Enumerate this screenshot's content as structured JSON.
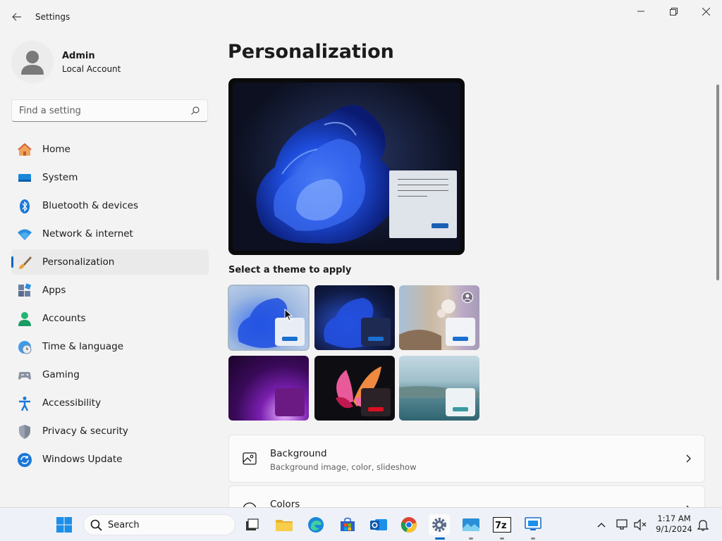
{
  "window": {
    "title": "Settings"
  },
  "profile": {
    "name": "Admin",
    "account_type": "Local Account"
  },
  "search": {
    "placeholder": "Find a setting"
  },
  "sidebar": {
    "items": [
      {
        "label": "Home",
        "icon": "home-icon"
      },
      {
        "label": "System",
        "icon": "system-icon"
      },
      {
        "label": "Bluetooth & devices",
        "icon": "bluetooth-icon"
      },
      {
        "label": "Network & internet",
        "icon": "wifi-icon"
      },
      {
        "label": "Personalization",
        "icon": "brush-icon",
        "active": true
      },
      {
        "label": "Apps",
        "icon": "apps-icon"
      },
      {
        "label": "Accounts",
        "icon": "person-icon"
      },
      {
        "label": "Time & language",
        "icon": "globe-clock-icon"
      },
      {
        "label": "Gaming",
        "icon": "gamepad-icon"
      },
      {
        "label": "Accessibility",
        "icon": "accessibility-icon"
      },
      {
        "label": "Privacy & security",
        "icon": "shield-icon"
      },
      {
        "label": "Windows Update",
        "icon": "update-icon"
      }
    ]
  },
  "main": {
    "title": "Personalization",
    "theme_section_label": "Select a theme to apply",
    "themes": [
      {
        "name": "windows-light",
        "selected": true
      },
      {
        "name": "windows-dark"
      },
      {
        "name": "spotlight"
      },
      {
        "name": "glow"
      },
      {
        "name": "captured-motion"
      },
      {
        "name": "flow"
      }
    ],
    "cards": [
      {
        "title": "Background",
        "subtitle": "Background image, color, slideshow",
        "icon": "image-icon"
      },
      {
        "title": "Colors",
        "icon": "palette-icon"
      }
    ]
  },
  "taskbar": {
    "search_label": "Search",
    "clock": {
      "time": "1:17 AM",
      "date": "9/1/2024"
    }
  },
  "colors": {
    "accent": "#0067c0",
    "background": "#f3f3f3",
    "card": "#fbfbfb"
  }
}
